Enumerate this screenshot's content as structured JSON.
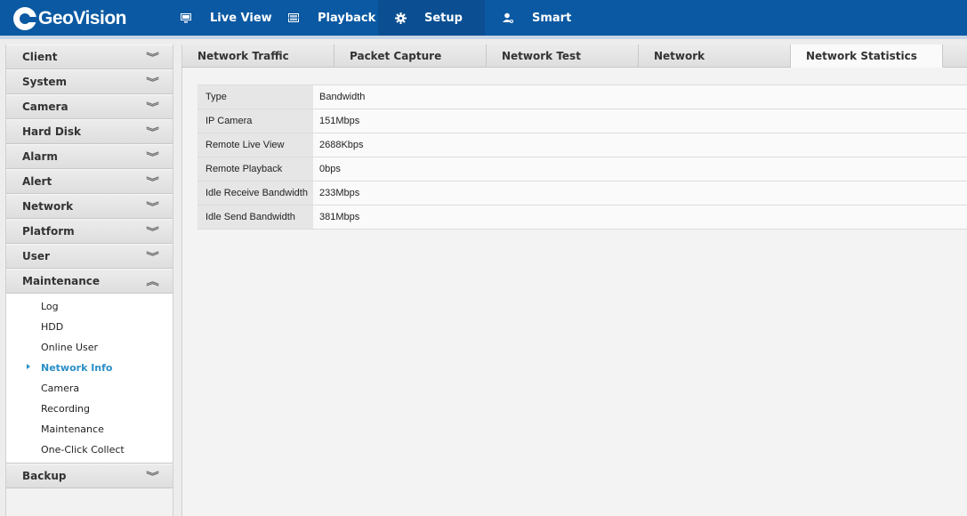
{
  "brand": {
    "name": "GeoVision",
    "accent": "#0b59a2",
    "active_link": "#2a8fc8"
  },
  "topnav": [
    {
      "label": "Live View",
      "icon": "monitor-icon"
    },
    {
      "label": "Playback",
      "icon": "film-icon"
    },
    {
      "label": "Setup",
      "icon": "gear-icon",
      "active": true
    },
    {
      "label": "Smart",
      "icon": "person-icon"
    }
  ],
  "sidebar": {
    "sections": [
      {
        "label": "Client"
      },
      {
        "label": "System"
      },
      {
        "label": "Camera"
      },
      {
        "label": "Hard Disk"
      },
      {
        "label": "Alarm"
      },
      {
        "label": "Alert"
      },
      {
        "label": "Network"
      },
      {
        "label": "Platform"
      },
      {
        "label": "User"
      },
      {
        "label": "Maintenance",
        "expanded": true
      },
      {
        "label": "Backup"
      }
    ],
    "maintenance_items": [
      {
        "label": "Log"
      },
      {
        "label": "HDD"
      },
      {
        "label": "Online User"
      },
      {
        "label": "Network Info",
        "active": true
      },
      {
        "label": "Camera"
      },
      {
        "label": "Recording"
      },
      {
        "label": "Maintenance"
      },
      {
        "label": "One-Click Collect"
      }
    ]
  },
  "tabs": [
    {
      "label": "Network Traffic"
    },
    {
      "label": "Packet Capture"
    },
    {
      "label": "Network Test"
    },
    {
      "label": "Network"
    },
    {
      "label": "Network Statistics",
      "active": true
    }
  ],
  "stats": {
    "header": {
      "type": "Type",
      "value": "Bandwidth"
    },
    "rows": [
      {
        "type": "IP Camera",
        "value": "151Mbps"
      },
      {
        "type": "Remote Live View",
        "value": "2688Kbps"
      },
      {
        "type": "Remote Playback",
        "value": "0bps"
      },
      {
        "type": "Idle Receive Bandwidth",
        "value": "233Mbps"
      },
      {
        "type": "Idle Send Bandwidth",
        "value": "381Mbps"
      }
    ]
  }
}
